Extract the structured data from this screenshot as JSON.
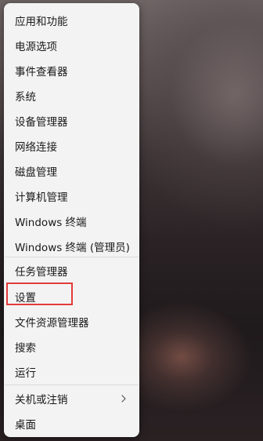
{
  "menu": {
    "items": [
      {
        "label": "应用和功能"
      },
      {
        "label": "电源选项"
      },
      {
        "label": "事件查看器"
      },
      {
        "label": "系统"
      },
      {
        "label": "设备管理器"
      },
      {
        "label": "网络连接"
      },
      {
        "label": "磁盘管理"
      },
      {
        "label": "计算机管理"
      },
      {
        "label": "Windows 终端"
      },
      {
        "label": "Windows 终端 (管理员)"
      },
      {
        "label": "任务管理器"
      },
      {
        "label": "设置"
      },
      {
        "label": "文件资源管理器"
      },
      {
        "label": "搜索"
      },
      {
        "label": "运行"
      },
      {
        "label": "关机或注销"
      },
      {
        "label": "桌面"
      }
    ],
    "submenu_icon": "chevron-right-icon",
    "highlighted_item": "设置",
    "highlight_color": "#e23b3b"
  }
}
